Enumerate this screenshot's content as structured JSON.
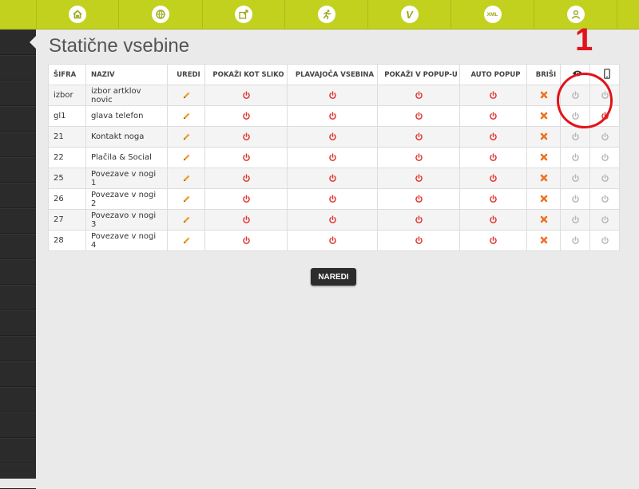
{
  "nav": {
    "tabs": [
      {
        "name": "home-icon"
      },
      {
        "name": "globe-icon"
      },
      {
        "name": "export-icon"
      },
      {
        "name": "runner-icon"
      },
      {
        "name": "v-icon",
        "text": "V"
      },
      {
        "name": "xml-icon",
        "text": "XML"
      },
      {
        "name": "user-icon"
      }
    ]
  },
  "page": {
    "title": "Statične vsebine"
  },
  "table": {
    "headers": {
      "sifra": "ŠIFRA",
      "naziv": "NAZIV",
      "uredi": "UREDI",
      "slika": "POKAŽI KOT SLIKO",
      "plavajoca": "PLAVAJOČA VSEBINA",
      "popup": "POKAŽI V POPUP-U",
      "auto": "AUTO POPUP",
      "brisi": "BRIŠI",
      "col_eye": "eye-icon",
      "col_mobile": "mobile-icon"
    },
    "rows": [
      {
        "sifra": "izbor",
        "naziv": "izbor artklov novic",
        "eye": "off",
        "mobile": "off"
      },
      {
        "sifra": "gl1",
        "naziv": "glava telefon",
        "eye": "off",
        "mobile": "on"
      },
      {
        "sifra": "21",
        "naziv": "Kontakt noga",
        "eye": "off",
        "mobile": "off"
      },
      {
        "sifra": "22",
        "naziv": "Plačila & Social",
        "eye": "off",
        "mobile": "off"
      },
      {
        "sifra": "25",
        "naziv": "Povezave v nogi 1",
        "eye": "off",
        "mobile": "off"
      },
      {
        "sifra": "26",
        "naziv": "Povezave v nogi 2",
        "eye": "off",
        "mobile": "off"
      },
      {
        "sifra": "27",
        "naziv": "Povezavo v nogi 3",
        "eye": "off",
        "mobile": "off"
      },
      {
        "sifra": "28",
        "naziv": "Povezave v nogi 4",
        "eye": "off",
        "mobile": "off"
      }
    ]
  },
  "actions": {
    "submit_label": "NAREDI"
  },
  "annotation": {
    "number": "1"
  },
  "colors": {
    "accent": "#c2d11e",
    "power_on": "#e0322b",
    "power_off": "#b5b5b5",
    "edit": "#f0a020",
    "delete": "#f07020",
    "annotation": "#e0141b"
  }
}
